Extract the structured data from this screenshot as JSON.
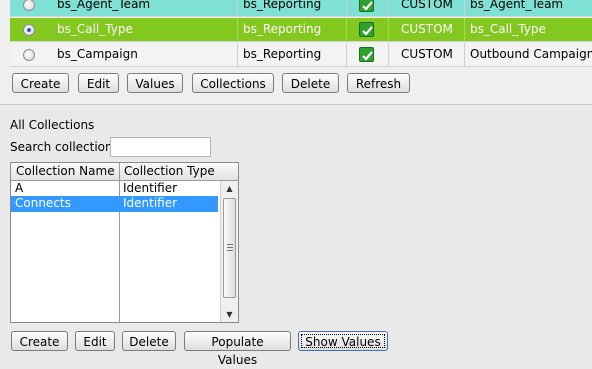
{
  "rows": [
    {
      "name": "bs_Agent_Team",
      "category": "bs_Reporting",
      "checked": true,
      "type": "CUSTOM",
      "display": "bs_Agent_Team",
      "selected": false
    },
    {
      "name": "bs_Call_Type",
      "category": "bs_Reporting",
      "checked": true,
      "type": "CUSTOM",
      "display": "bs_Call_Type",
      "selected": true
    },
    {
      "name": "bs_Campaign",
      "category": "bs_Reporting",
      "checked": true,
      "type": "CUSTOM",
      "display": "Outbound Campaign",
      "selected": false
    }
  ],
  "top_toolbar": {
    "create": "Create",
    "edit": "Edit",
    "values": "Values",
    "collections": "Collections",
    "delete": "Delete",
    "refresh": "Refresh"
  },
  "collections": {
    "title": "All Collections",
    "search_label": "Search collection:",
    "search_value": "",
    "columns": [
      "Collection Name",
      "Collection Type"
    ],
    "items": [
      {
        "name": "A",
        "type": "Identifier",
        "selected": false
      },
      {
        "name": "Connects",
        "type": "Identifier",
        "selected": true
      }
    ]
  },
  "bottom_toolbar": {
    "create": "Create",
    "edit": "Edit",
    "delete": "Delete",
    "populate": "Populate Values",
    "show": "Show Values"
  },
  "colors": {
    "selected_row": "#82c81f",
    "teal_row": "#7fe0d4",
    "list_selection": "#3399ff",
    "check_green": "#2fa12f"
  },
  "icons": [
    "radio-button-icon",
    "checkmark-icon",
    "scroll-up-arrow-icon",
    "scroll-down-arrow-icon",
    "scroll-grip-icon"
  ]
}
